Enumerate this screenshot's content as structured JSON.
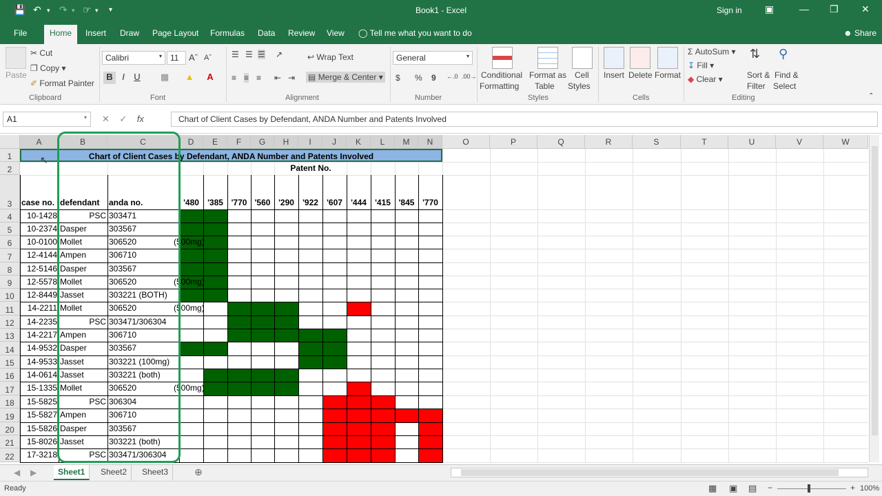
{
  "window": {
    "title": "Book1  -  Excel",
    "signin": "Sign in"
  },
  "menu": {
    "file": "File",
    "tabs": [
      "Home",
      "Insert",
      "Draw",
      "Page Layout",
      "Formulas",
      "Data",
      "Review",
      "View"
    ],
    "tellme": "Tell me what you want to do",
    "share": "Share"
  },
  "ribbon": {
    "clipboard": {
      "paste": "Paste",
      "cut": "Cut",
      "copy": "Copy",
      "format_painter": "Format Painter",
      "label": "Clipboard"
    },
    "font": {
      "name": "Calibri",
      "size": "11",
      "label": "Font",
      "bold": "B",
      "italic": "I",
      "underline": "U"
    },
    "alignment": {
      "wrap": "Wrap Text",
      "merge": "Merge & Center",
      "label": "Alignment"
    },
    "number": {
      "format": "General",
      "currency": "$",
      "percent": "%",
      "comma": "9",
      "label": "Number"
    },
    "styles": {
      "conditional": "Conditional",
      "conditional2": "Formatting",
      "format_as": "Format as",
      "format_as2": "Table",
      "cell": "Cell",
      "cell2": "Styles",
      "label": "Styles"
    },
    "cells": {
      "insert": "Insert",
      "delete": "Delete",
      "format": "Format",
      "label": "Cells"
    },
    "editing": {
      "autosum": "AutoSum",
      "fill": "Fill",
      "clear": "Clear",
      "sort": "Sort &",
      "sort2": "Filter",
      "find": "Find &",
      "find2": "Select",
      "label": "Editing"
    }
  },
  "formula_bar": {
    "name_box": "A1",
    "fx": "fx",
    "content": "Chart of Client Cases by Defendant, ANDA Number and Patents Involved"
  },
  "columns": [
    "A",
    "B",
    "C",
    "D",
    "E",
    "F",
    "G",
    "H",
    "I",
    "J",
    "K",
    "L",
    "M",
    "N",
    "O",
    "P",
    "Q",
    "R",
    "S",
    "T",
    "U",
    "V",
    "W"
  ],
  "rows": [
    "1",
    "2",
    "3",
    "4",
    "5",
    "6",
    "7",
    "8",
    "9",
    "10",
    "11",
    "12",
    "13",
    "14",
    "15",
    "16",
    "17",
    "18",
    "19",
    "20",
    "21",
    "22"
  ],
  "sheet": {
    "title": "Chart of Client Cases by Defendant, ANDA Number and Patents Involved",
    "patent_header": "Patent No.",
    "headers": {
      "case": "case no.",
      "defendant": "defendant",
      "anda": "anda no."
    },
    "patents": [
      "'480",
      "'385",
      "'770",
      "'560",
      "'290",
      "'922",
      "'607",
      "'444",
      "'415",
      "'845",
      "'770"
    ],
    "records": [
      {
        "case": "10-1428",
        "def": "PSC",
        "anda": "303471",
        "note": ""
      },
      {
        "case": "10-2374",
        "def": "Dasper",
        "anda": "303567",
        "note": ""
      },
      {
        "case": "10-0100",
        "def": "Mollet",
        "anda": "306520",
        "note": "(500mg)"
      },
      {
        "case": "12-4144",
        "def": "Ampen",
        "anda": "306710",
        "note": ""
      },
      {
        "case": "12-5146",
        "def": "Dasper",
        "anda": "303567",
        "note": ""
      },
      {
        "case": "12-5578",
        "def": "Mollet",
        "anda": "306520",
        "note": "(500mg)"
      },
      {
        "case": "12-8449",
        "def": "Jasset",
        "anda": "303221 (BOTH)",
        "note": ""
      },
      {
        "case": "14-2211",
        "def": "Mollet",
        "anda": "306520",
        "note": "(500mg)"
      },
      {
        "case": "14-2235",
        "def": "PSC",
        "anda": "303471/306304",
        "note": ""
      },
      {
        "case": "14-2217",
        "def": "Ampen",
        "anda": "306710",
        "note": ""
      },
      {
        "case": "14-9532",
        "def": "Dasper",
        "anda": "303567",
        "note": ""
      },
      {
        "case": "14-9533",
        "def": "Jasset",
        "anda": "303221 (100mg)",
        "note": ""
      },
      {
        "case": "14-0614",
        "def": "Jasset",
        "anda": "303221 (both)",
        "note": ""
      },
      {
        "case": "15-1335",
        "def": "Mollet",
        "anda": "306520",
        "note": "(500mg)"
      },
      {
        "case": "15-5825",
        "def": "PSC",
        "anda": "306304",
        "note": ""
      },
      {
        "case": "15-5827",
        "def": "Ampen",
        "anda": "306710",
        "note": ""
      },
      {
        "case": "15-5826",
        "def": "Dasper",
        "anda": "303567",
        "note": ""
      },
      {
        "case": "15-8026",
        "def": "Jasset",
        "anda": "303221 (both)",
        "note": ""
      },
      {
        "case": "17-3218",
        "def": "PSC",
        "anda": "303471/306304",
        "note": ""
      }
    ],
    "fills": [
      [
        "G",
        "G",
        "",
        "",
        "",
        "",
        "",
        "",
        "",
        "",
        ""
      ],
      [
        "G",
        "G",
        "",
        "",
        "",
        "",
        "",
        "",
        "",
        "",
        ""
      ],
      [
        "G",
        "G",
        "",
        "",
        "",
        "",
        "",
        "",
        "",
        "",
        ""
      ],
      [
        "G",
        "G",
        "",
        "",
        "",
        "",
        "",
        "",
        "",
        "",
        ""
      ],
      [
        "G",
        "G",
        "",
        "",
        "",
        "",
        "",
        "",
        "",
        "",
        ""
      ],
      [
        "G",
        "G",
        "",
        "",
        "",
        "",
        "",
        "",
        "",
        "",
        ""
      ],
      [
        "G",
        "G",
        "",
        "",
        "",
        "",
        "",
        "",
        "",
        "",
        ""
      ],
      [
        "",
        "",
        "G",
        "G",
        "G",
        "",
        "",
        "R",
        "",
        "",
        ""
      ],
      [
        "",
        "",
        "G",
        "G",
        "G",
        "",
        "",
        "",
        "",
        "",
        ""
      ],
      [
        "",
        "",
        "G",
        "G",
        "G",
        "G",
        "G",
        "",
        "",
        "",
        ""
      ],
      [
        "G",
        "G",
        "",
        "",
        "",
        "G",
        "G",
        "",
        "",
        "",
        ""
      ],
      [
        "",
        "",
        "",
        "",
        "",
        "G",
        "G",
        "",
        "",
        "",
        ""
      ],
      [
        "",
        "G",
        "G",
        "G",
        "G",
        "",
        "",
        "",
        "",
        "",
        ""
      ],
      [
        "",
        "G",
        "G",
        "G",
        "G",
        "",
        "",
        "R",
        "",
        "",
        ""
      ],
      [
        "",
        "",
        "",
        "",
        "",
        "",
        "R",
        "R",
        "R",
        "",
        ""
      ],
      [
        "",
        "",
        "",
        "",
        "",
        "",
        "R",
        "R",
        "R",
        "R",
        "R"
      ],
      [
        "",
        "",
        "",
        "",
        "",
        "",
        "R",
        "R",
        "R",
        "",
        "R"
      ],
      [
        "",
        "",
        "",
        "",
        "",
        "",
        "R",
        "R",
        "R",
        "",
        "R"
      ],
      [
        "",
        "",
        "",
        "",
        "",
        "",
        "R",
        "R",
        "R",
        "",
        "R"
      ]
    ]
  },
  "sheet_tabs": [
    "Sheet1",
    "Sheet2",
    "Sheet3"
  ],
  "status": {
    "ready": "Ready",
    "zoom": "100%"
  },
  "colors": {
    "excel_green": "#217346",
    "fill_green": "#006100",
    "fill_red": "#ff0000",
    "title_fill": "#8db4e2",
    "highlight": "#1f9d55"
  }
}
